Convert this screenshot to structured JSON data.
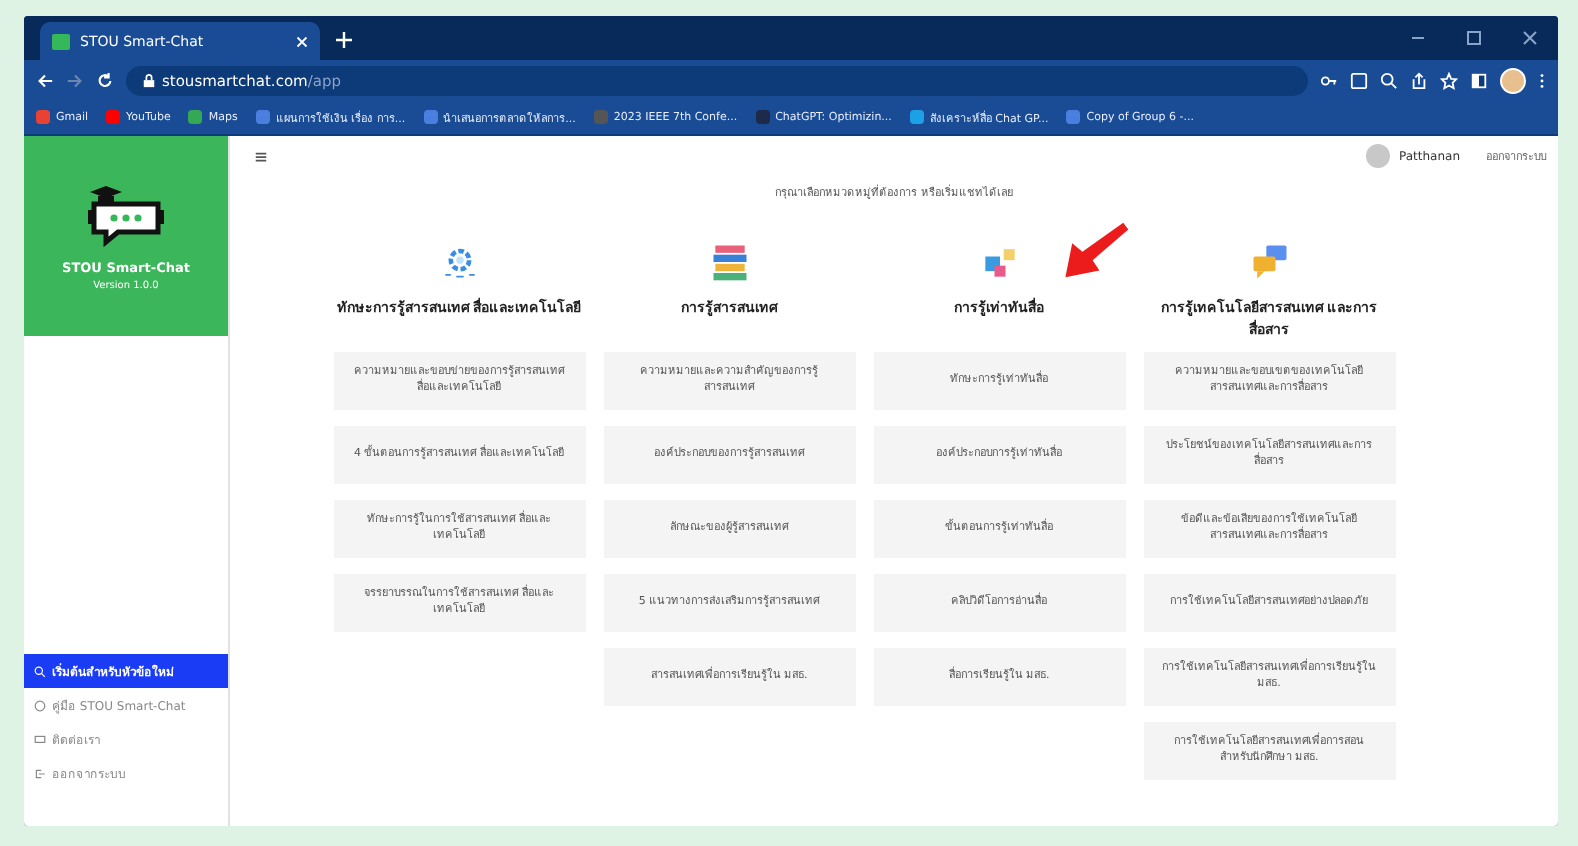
{
  "browser": {
    "tab_title": "STOU Smart-Chat",
    "url_host": "stousmartchat.com",
    "url_path": "/app",
    "bookmarks": [
      {
        "label": "Gmail",
        "kind": "gmail"
      },
      {
        "label": "YouTube",
        "kind": "youtube"
      },
      {
        "label": "Maps",
        "kind": "maps"
      },
      {
        "label": "แผนการใช้เงิน เรื่อง การ...",
        "kind": "site"
      },
      {
        "label": "นำเสนอการตลาดให้ลการ...",
        "kind": "site"
      },
      {
        "label": "2023 IEEE 7th Confe...",
        "kind": "doc"
      },
      {
        "label": "ChatGPT: Optimizin...",
        "kind": "dark"
      },
      {
        "label": "สังเคราะห์สื่อ Chat GP...",
        "kind": "globe"
      },
      {
        "label": "Copy of Group 6 -...",
        "kind": "site"
      }
    ]
  },
  "sidebar": {
    "app_name": "STOU Smart-Chat",
    "version": "Version 1.0.0",
    "items": [
      {
        "label": "เริ่มต้นสำหรับหัวข้อใหม่",
        "kind": "search",
        "selected": true
      },
      {
        "label": "คู่มือ STOU Smart-Chat",
        "kind": "help",
        "selected": false
      },
      {
        "label": "ติดต่อเรา",
        "kind": "chat",
        "selected": false
      },
      {
        "label": "ออกจากระบบ",
        "kind": "logout",
        "selected": false
      }
    ]
  },
  "header": {
    "user_name": "Patthanan",
    "logout": "ออกจากระบบ"
  },
  "prompt": "กรุณาเลือกหมวดหมู่ที่ต้องการ หรือเริ่มแชทได้เลย",
  "categories": [
    {
      "title": "ทักษะการรู้สารสนเทศ สื่อและเทคโนโลยี",
      "kind": "gear",
      "topics": [
        "ความหมายและขอบข่ายของการรู้สารสนเทศ สื่อและเทคโนโลยี",
        "4 ขั้นตอนการรู้สารสนเทศ สื่อและเทคโนโลยี",
        "ทักษะการรู้ในการใช้สารสนเทศ สื่อและเทคโนโลยี",
        "จรรยาบรรณในการใช้สารสนเทศ สื่อและเทคโนโลยี"
      ]
    },
    {
      "title": "การรู้สารสนเทศ",
      "kind": "books",
      "topics": [
        "ความหมายและความสำคัญของการรู้สารสนเทศ",
        "องค์ประกอบของการรู้สารสนเทศ",
        "ลักษณะของผู้รู้สารสนเทศ",
        "5 แนวทางการส่งเสริมการรู้สารสนเทศ",
        "สารสนเทศเพื่อการเรียนรู้ใน มสธ."
      ]
    },
    {
      "title": "การรู้เท่าทันสื่อ",
      "kind": "media",
      "topics": [
        "ทักษะการรู้เท่าทันสื่อ",
        "องค์ประกอบการรู้เท่าทันสื่อ",
        "ขั้นตอนการรู้เท่าทันสื่อ",
        "คลิปวิดีโอการอ่านสื่อ",
        "สื่อการเรียนรู้ใน มสธ."
      ]
    },
    {
      "title": "การรู้เทคโนโลยีสารสนเทศ และการสื่อสาร",
      "kind": "chat",
      "topics": [
        "ความหมายและขอบเขตของเทคโนโลยีสารสนเทศและการสื่อสาร",
        "ประโยชน์ของเทคโนโลยีสารสนเทศและการสื่อสาร",
        "ข้อดีและข้อเสียของการใช้เทคโนโลยีสารสนเทศและการสื่อสาร",
        "การใช้เทคโนโลยีสารสนเทศอย่างปลอดภัย",
        "การใช้เทคโนโลยีสารสนเทศเพื่อการเรียนรู้ใน มสธ.",
        "การใช้เทคโนโลยีสารสนเทศเพื่อการสอนสำหรับนักศึกษา มสธ."
      ]
    }
  ]
}
